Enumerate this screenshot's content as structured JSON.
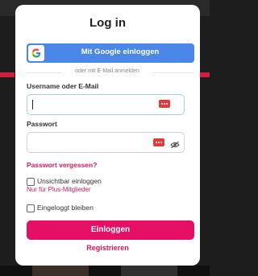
{
  "modal": {
    "title": "Log in",
    "google_button": {
      "label": "Mit Google einloggen",
      "icon": "google-g-icon",
      "color": "#4a87e8"
    },
    "divider_text": "oder mit E-Mail anmelden",
    "username": {
      "label": "Username oder E-Mail",
      "value": "",
      "placeholder": ""
    },
    "password": {
      "label": "Passwort",
      "value": "",
      "placeholder": ""
    },
    "forgot_password": "Passwort vergessen?",
    "invisible_login": {
      "label": "Unsichtbar einloggen",
      "checked": false,
      "note": "Nur für Plus-Mitglieder"
    },
    "stay_logged_in": {
      "label": "Eingeloggt bleiben",
      "checked": false
    },
    "login_button": "Einloggen",
    "register_link": "Registrieren",
    "accent_color": "#e50f66"
  }
}
